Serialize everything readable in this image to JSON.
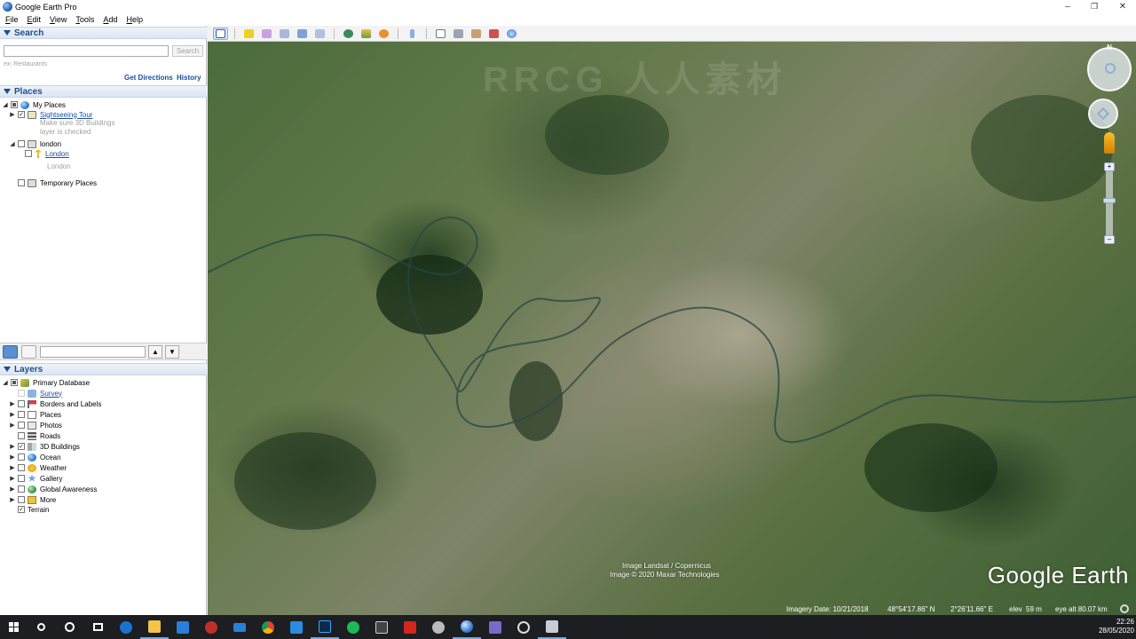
{
  "window": {
    "title": "Google Earth Pro",
    "minimize": "–",
    "restore": "❐",
    "close": "✕"
  },
  "menu": [
    "File",
    "Edit",
    "View",
    "Tools",
    "Add",
    "Help"
  ],
  "search": {
    "header": "Search",
    "input_value": "",
    "placeholder": "ex: Restaurants",
    "search_button": "Search",
    "get_directions": "Get Directions",
    "history": "History"
  },
  "places": {
    "header": "Places",
    "items": [
      {
        "label": "My Places"
      },
      {
        "label": "Sightseeing Tour",
        "note1": "Make sure 3D Buildings",
        "note2": "layer is checked"
      },
      {
        "label": "london"
      },
      {
        "label": "London",
        "sub": "London"
      },
      {
        "label": "Temporary Places"
      }
    ]
  },
  "layers": {
    "header": "Layers",
    "items": [
      {
        "label": "Primary Database"
      },
      {
        "label": "Survey"
      },
      {
        "label": "Borders and Labels"
      },
      {
        "label": "Places"
      },
      {
        "label": "Photos"
      },
      {
        "label": "Roads"
      },
      {
        "label": "3D Buildings"
      },
      {
        "label": "Ocean"
      },
      {
        "label": "Weather"
      },
      {
        "label": "Gallery"
      },
      {
        "label": "Global Awareness"
      },
      {
        "label": "More"
      },
      {
        "label": "Terrain"
      }
    ]
  },
  "map": {
    "credit_line1": "Image Landsat / Copernicus",
    "credit_line2": "Image © 2020 Maxar Technologies",
    "logo": "Google Earth",
    "compass_n": "N",
    "status": {
      "imagery_date": "Imagery Date: 10/21/2018",
      "lat": "48°54'17.86\" N",
      "lon": "2°26'11.66\" E",
      "elev_label": "elev",
      "elev": "59 m",
      "eye_alt": "eye alt  80.07 km"
    }
  },
  "taskbar": {
    "time": "22:26",
    "date": "28/05/2020"
  },
  "watermark": "RRCG 人人素材"
}
